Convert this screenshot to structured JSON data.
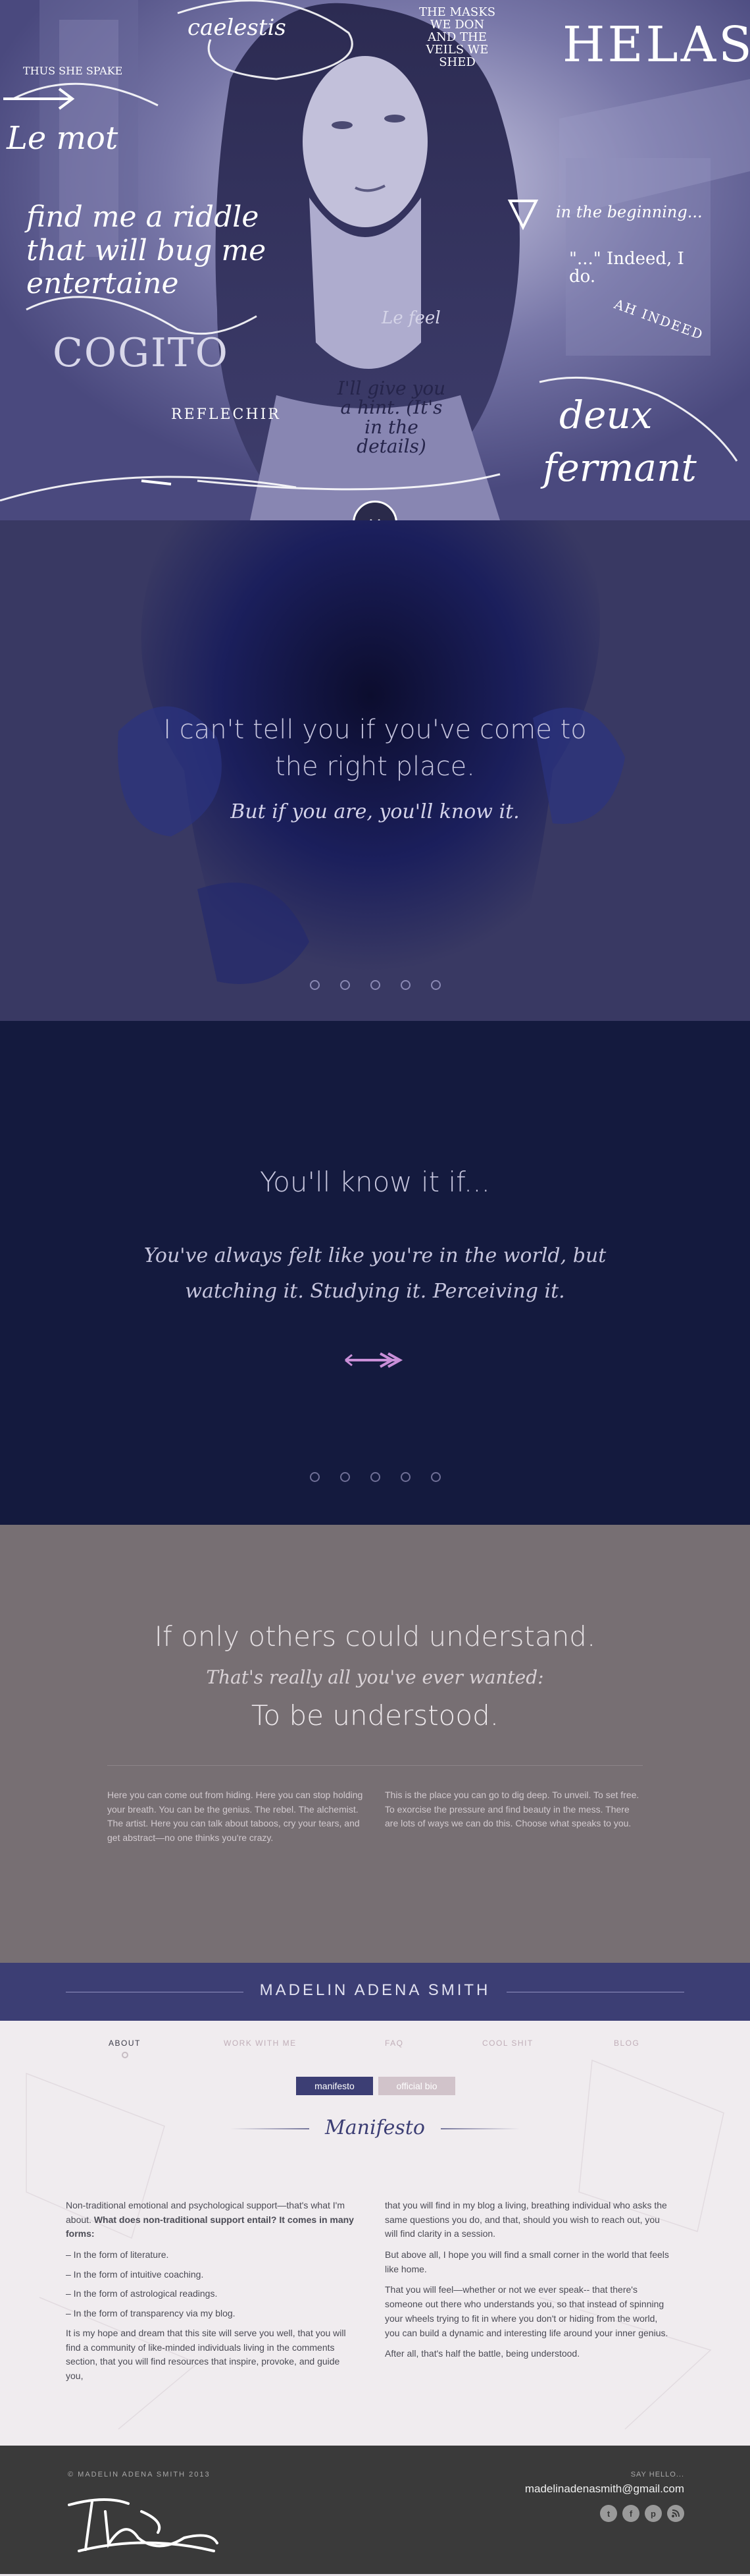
{
  "hero": {
    "doodles": {
      "caelestis": "caelestis",
      "masks": "THE MASKS WE DON AND THE VEILS WE SHED",
      "helas": "HELAS!",
      "thus": "THUS SHE SPAKE",
      "lemot": "Le mot",
      "riddle": "find me a riddle that will bug me entertaine",
      "cogito": "COGITO",
      "reflechir": "REFLECHIR",
      "beginning": "in the beginning...",
      "indeed": "\"...\" Indeed, I do.",
      "ahindeed": "AH INDEED",
      "hint": "I'll give you a hint. (It's in the details)",
      "deux": "deux",
      "fermant": "fermant",
      "lefeel": "Le feel"
    }
  },
  "slide1": {
    "line1": "I can't tell you if you've come to",
    "line2": "the right place.",
    "script": "But if you are, you'll know it."
  },
  "slide2": {
    "heading": "You'll know it if...",
    "script_line1": "You've always felt like you're in the world, but",
    "script_line2": "watching it. Studying it. Perceiving it."
  },
  "understand": {
    "heading": "If only others could understand.",
    "script": "That's really all you've ever wanted:",
    "subheading": "To be understood.",
    "col1": "Here you can come out from hiding. Here you can stop holding your breath. You can be the genius. The rebel. The alchemist. The artist. Here you can talk about taboos, cry your tears, and get abstract—no one thinks you're crazy.",
    "col2": "This is the place you can go to dig deep. To unveil. To set free. To exorcise the pressure and find beauty in the mess. There are lots of ways we can do this. Choose what speaks to you."
  },
  "namebar": {
    "name": "MADELIN ADENA SMITH"
  },
  "nav": {
    "items": [
      "ABOUT",
      "WORK WITH ME",
      "FAQ",
      "COOL SHIT",
      "BLOG"
    ]
  },
  "about": {
    "tab_active": "manifesto",
    "tab_inactive": "official bio",
    "title": "Manifesto",
    "left": {
      "p1_a": "Non-traditional emotional and psychological support—that's what I'm about. ",
      "p1_b": "What does non-traditional support entail? It comes in many forms:",
      "list": [
        "– In the form of literature.",
        "– In the form of intuitive coaching.",
        "– In the form of astrological readings.",
        "– In the form of transparency via my blog."
      ],
      "p2": "It is my hope and dream that this site will serve you well, that you will find a community of like-minded individuals living in the comments section, that you will find resources that inspire, provoke, and guide you,"
    },
    "right": {
      "p1": "that you will find in my blog a living, breathing individual who asks the same questions you do, and that, should you wish to reach out, you will find clarity in a session.",
      "p2": "But above all, I hope you will find a small corner in the world that feels like home.",
      "p3": "That you will feel—whether or not we ever speak-- that there's someone out there who understands you, so that instead of spinning your wheels trying to fit in where you don't or hiding from the world, you can build a dynamic and interesting life around your inner genius.",
      "p4": "After all, that's half the battle, being understood."
    }
  },
  "footer": {
    "copyright": "© MADELIN ADENA SMITH 2013",
    "say_hello": "SAY HELLO...",
    "email": "madelinadenasmith@gmail.com",
    "social": [
      "twitter-icon",
      "facebook-icon",
      "pinterest-icon",
      "rss-icon"
    ]
  },
  "colors": {
    "hero": "#55548a",
    "slide1": "#393963",
    "slide2": "#141a3e",
    "understand": "#776f73",
    "namebar": "#3c3e74",
    "about_bg": "#f0ecef",
    "accent_arrow": "#c98fd8",
    "footer": "#3a3a3a"
  }
}
